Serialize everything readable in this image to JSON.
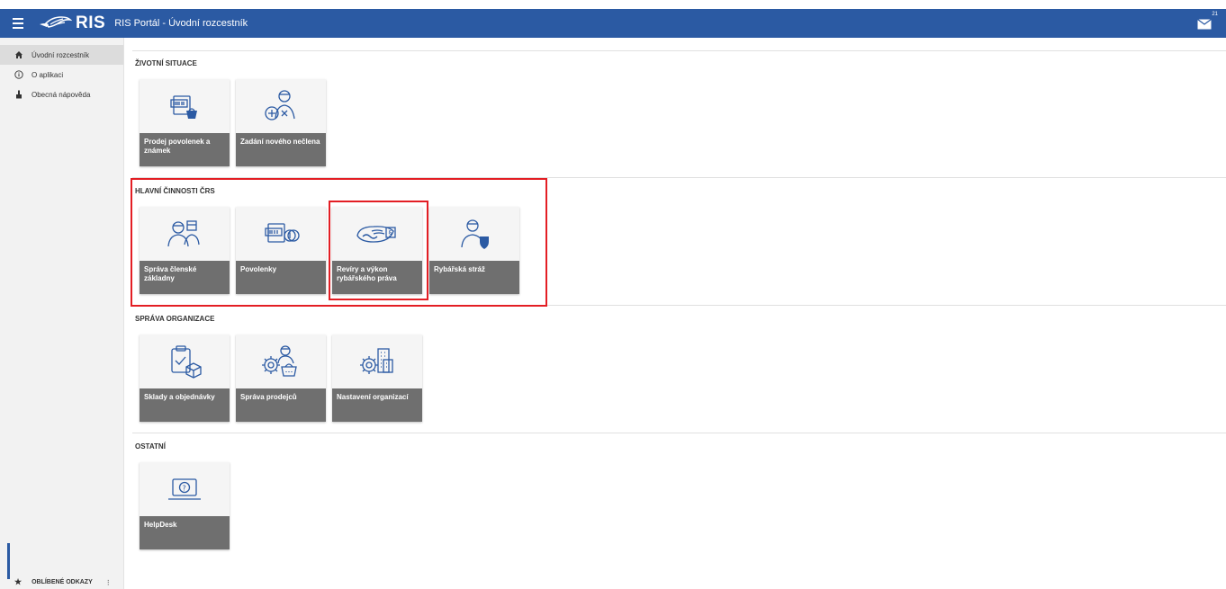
{
  "header": {
    "logo_text": "RIS",
    "title": "RIS Portál - Úvodní rozcestník",
    "mail_badge": "21",
    "accent_color": "#2b5aa3"
  },
  "sidebar": {
    "items": [
      {
        "label": "Úvodní rozcestník",
        "icon": "home-icon",
        "active": true
      },
      {
        "label": "O aplikaci",
        "icon": "info-icon"
      },
      {
        "label": "Obecná nápověda",
        "icon": "help-hand-icon"
      }
    ],
    "favorites_label": "OBLÍBENÉ ODKAZY",
    "favorites_more": "⋮"
  },
  "sections": [
    {
      "title": "ŽIVOTNÍ SITUACE",
      "tiles": [
        {
          "label": "Prodej povolenek a známek",
          "icon": "permit-shop-icon"
        },
        {
          "label": "Zadání nového nečlena",
          "icon": "add-person-icon"
        }
      ]
    },
    {
      "title": "HLAVNÍ ČINNOSTI ČRS",
      "tiles": [
        {
          "label": "Správa členské základny",
          "icon": "members-icon"
        },
        {
          "label": "Povolenky",
          "icon": "permit-icon"
        },
        {
          "label": "Revíry a výkon rybářského práva",
          "icon": "fishing-ground-icon"
        },
        {
          "label": "Rybářská stráž",
          "icon": "guard-icon"
        }
      ]
    },
    {
      "title": "SPRÁVA ORGANIZACE",
      "tiles": [
        {
          "label": "Sklady a objednávky",
          "icon": "warehouse-icon"
        },
        {
          "label": "Správa prodejců",
          "icon": "sellers-icon"
        },
        {
          "label": "Nastavení organizací",
          "icon": "org-settings-icon"
        }
      ]
    },
    {
      "title": "OSTATNÍ",
      "tiles": [
        {
          "label": "HelpDesk",
          "icon": "helpdesk-icon"
        }
      ]
    }
  ],
  "highlight_color": "#e31e24"
}
